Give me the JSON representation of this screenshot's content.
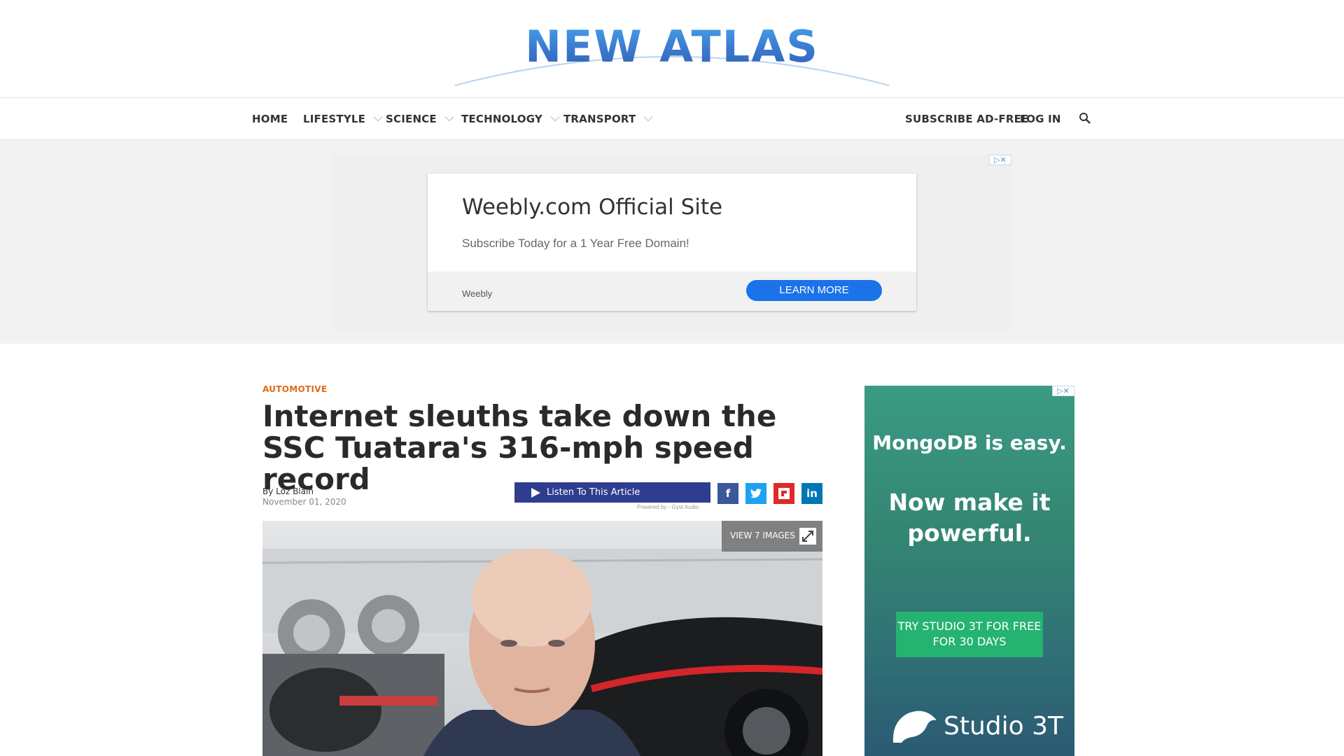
{
  "site": {
    "logo": "NEW ATLAS"
  },
  "nav": {
    "items": [
      {
        "label": "HOME"
      },
      {
        "label": "LIFESTYLE"
      },
      {
        "label": "SCIENCE"
      },
      {
        "label": "TECHNOLOGY"
      },
      {
        "label": "TRANSPORT"
      }
    ],
    "subscribe": "SUBSCRIBE AD-FREE",
    "login": "LOG IN",
    "search_icon": "search-icon"
  },
  "top_ad": {
    "title": "Weebly.com Official Site",
    "subtitle": "Subscribe Today for a 1 Year Free Domain!",
    "brand": "Weebly",
    "cta": "LEARN MORE",
    "adchoices": "▷✕"
  },
  "article": {
    "category": "AUTOMOTIVE",
    "headline": "Internet sleuths take down the SSC Tuatara's 316-mph speed record",
    "byline": "By Loz Blain",
    "date": "November 01, 2020",
    "listen_label": "Listen To This Article",
    "powered_by": "Powered by  ◦ Gyst Audio",
    "share": [
      {
        "name": "facebook",
        "glyph": "f",
        "color": "#3b5998"
      },
      {
        "name": "twitter",
        "glyph": "t",
        "color": "#1da1f2"
      },
      {
        "name": "flipboard",
        "glyph": "f",
        "color": "#e12828"
      },
      {
        "name": "linkedin",
        "glyph": "in",
        "color": "#0077b5"
      }
    ],
    "view_images": "VIEW 7 IMAGES"
  },
  "side_ad": {
    "line1": "MongoDB is easy.",
    "line2": "Now make it powerful.",
    "cta": "TRY STUDIO 3T FOR FREE FOR 30 DAYS",
    "brand": "Studio 3T",
    "adchoices": "▷✕"
  }
}
